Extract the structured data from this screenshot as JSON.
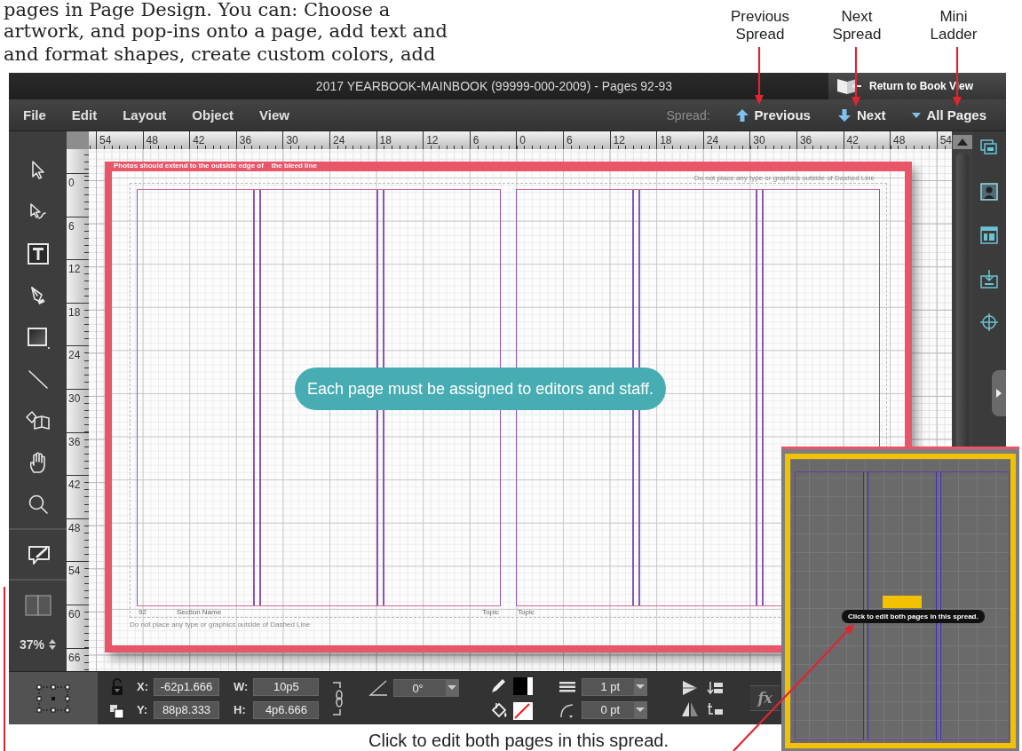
{
  "intro_text": [
    "pages in Page Design. You can: Choose a",
    "artwork, and pop-ins onto a page, add text and",
    "and format shapes, create custom colors, add"
  ],
  "callouts": [
    {
      "kind": "previous",
      "label": "Previous Spread"
    },
    {
      "kind": "next",
      "label": "Next Spread"
    },
    {
      "kind": "ladder",
      "label": "Mini Ladder"
    }
  ],
  "window": {
    "title": "2017 YEARBOOK-MAINBOOK  (99999-000-2009) - Pages 92-93",
    "return_button": "Return to Book View"
  },
  "menu": [
    "File",
    "Edit",
    "Layout",
    "Object",
    "View"
  ],
  "spread_nav": {
    "label": "Spread:",
    "buttons": [
      {
        "kind": "previous",
        "label": "Previous"
      },
      {
        "kind": "next",
        "label": "Next"
      },
      {
        "kind": "pages",
        "label": "All Pages"
      }
    ]
  },
  "tool_groups": [
    [
      {
        "kind": "select"
      },
      {
        "kind": "direct-select"
      },
      {
        "kind": "text"
      },
      {
        "kind": "pen"
      },
      {
        "kind": "rectangle"
      },
      {
        "kind": "line"
      },
      {
        "kind": "frame"
      },
      {
        "kind": "hand"
      },
      {
        "kind": "zoom"
      }
    ],
    [
      {
        "kind": "comment"
      }
    ],
    [
      {
        "kind": "spread"
      }
    ]
  ],
  "zoom": "37%",
  "ruler": {
    "horizontal": [
      "54",
      "48",
      "42",
      "36",
      "30",
      "24",
      "18",
      "12",
      "6",
      "0",
      "6",
      "12",
      "18",
      "24",
      "30",
      "36",
      "42",
      "48",
      "54"
    ],
    "vertical": [
      "0",
      "6",
      "12",
      "18",
      "24",
      "30",
      "36",
      "42",
      "48",
      "54",
      "60",
      "66"
    ]
  },
  "spread": {
    "bleed_note": "Photos should extend to the outside edge of    the bleed line",
    "safety_note_top": "Do not place any type or graphics outside of Dashed Line",
    "safety_note_bottom": "Do not place any type or graphics outside of Dashed Line",
    "folio": "92",
    "section": "Section Name",
    "left_topic": "Topic",
    "right_topic": "Topic"
  },
  "overlay_note": "Each page must be assigned to editors and staff.",
  "right_panel": [
    {
      "kind": "pages"
    },
    {
      "kind": "portrait"
    },
    {
      "kind": "layout"
    },
    {
      "kind": "import"
    },
    {
      "kind": "crosshair"
    }
  ],
  "properties": {
    "fields": [
      {
        "label": "X:",
        "value": "-62p1.666"
      },
      {
        "label": "W:",
        "value": "10p5"
      },
      {
        "label": "Y:",
        "value": "88p8.333"
      },
      {
        "label": "H:",
        "value": "4p6.666"
      }
    ],
    "angle": "0°",
    "stroke_weight": "1 pt",
    "corner_radius": "0 pt",
    "function_button": "fx"
  },
  "mini_ladder": {
    "hint": "Click to edit both pages in this spread."
  },
  "caption": "Click to edit both pages in this spread."
}
